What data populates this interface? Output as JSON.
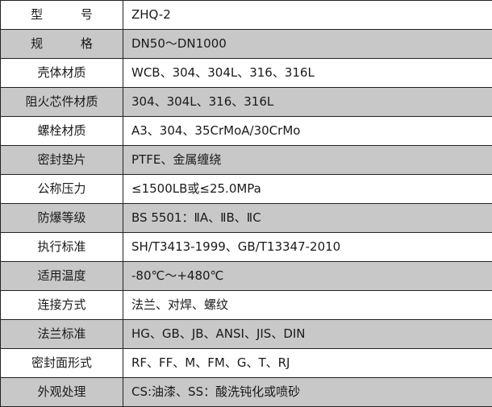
{
  "colors": {
    "shaded_row": "#c8c8c8",
    "plain_row": "#ffffff",
    "border": "#222222",
    "text": "#1a1a1a"
  },
  "rows": [
    {
      "label": "型 号",
      "value": "ZHQ-2"
    },
    {
      "label": "规 格",
      "value": "DN50～DN1000"
    },
    {
      "label": "壳体材质",
      "value": "WCB、304、304L、316、316L"
    },
    {
      "label": "阻火芯件材质",
      "value": "304、304L、316、316L"
    },
    {
      "label": "螺栓材质",
      "value": "A3、304、35CrMoA/30CrMo"
    },
    {
      "label": "密封垫片",
      "value": "PTFE、金属缠绕"
    },
    {
      "label": "公称压力",
      "value": "≤1500LB或≤25.0MPa"
    },
    {
      "label": "防爆等级",
      "value": "BS 5501：ⅡA、ⅡB、ⅡC"
    },
    {
      "label": "执行标准",
      "value": "SH/T3413-1999、GB/T13347-2010"
    },
    {
      "label": "适用温度",
      "value": "-80℃～+480℃"
    },
    {
      "label": "连接方式",
      "value": "法兰、对焊、螺纹"
    },
    {
      "label": "法兰标准",
      "value": "HG、GB、JB、ANSI、JIS、DIN"
    },
    {
      "label": "密封面形式",
      "value": "RF、FF、M、FM、G、T、RJ"
    },
    {
      "label": "外观处理",
      "value": "CS:油漆、SS：酸洗钝化或喷砂"
    }
  ]
}
